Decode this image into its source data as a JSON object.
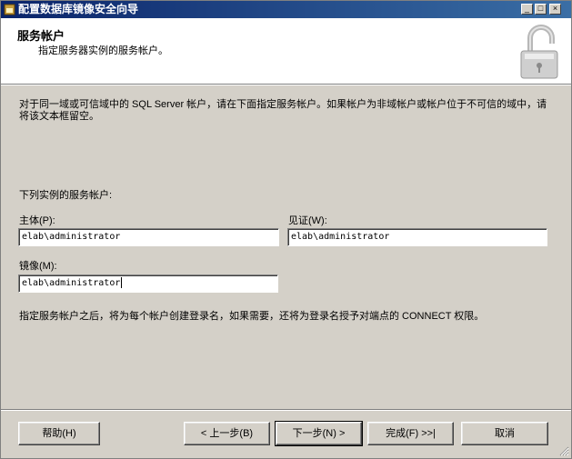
{
  "window": {
    "title": "配置数据库镜像安全向导"
  },
  "header": {
    "title": "服务帐户",
    "subtitle": "指定服务器实例的服务帐户。"
  },
  "body": {
    "description": "对于同一域或可信域中的 SQL Server 帐户，请在下面指定服务帐户。如果帐户为非域帐户或帐户位于不可信的域中，请将该文本框留空。",
    "section_label": "下列实例的服务帐户:",
    "principal": {
      "label": "主体(P):",
      "value": "elab\\administrator"
    },
    "witness": {
      "label": "见证(W):",
      "value": "elab\\administrator"
    },
    "mirror": {
      "label": "镜像(M):",
      "value": "elab\\administrator"
    },
    "note": "指定服务帐户之后，将为每个帐户创建登录名，如果需要，还将为登录名授予对端点的 CONNECT 权限。"
  },
  "buttons": {
    "help": "帮助(H)",
    "back": "< 上一步(B)",
    "next": "下一步(N) >",
    "finish": "完成(F) >>|",
    "cancel": "取消"
  },
  "icons": {
    "title": "app-icon",
    "header": "padlock-icon"
  }
}
